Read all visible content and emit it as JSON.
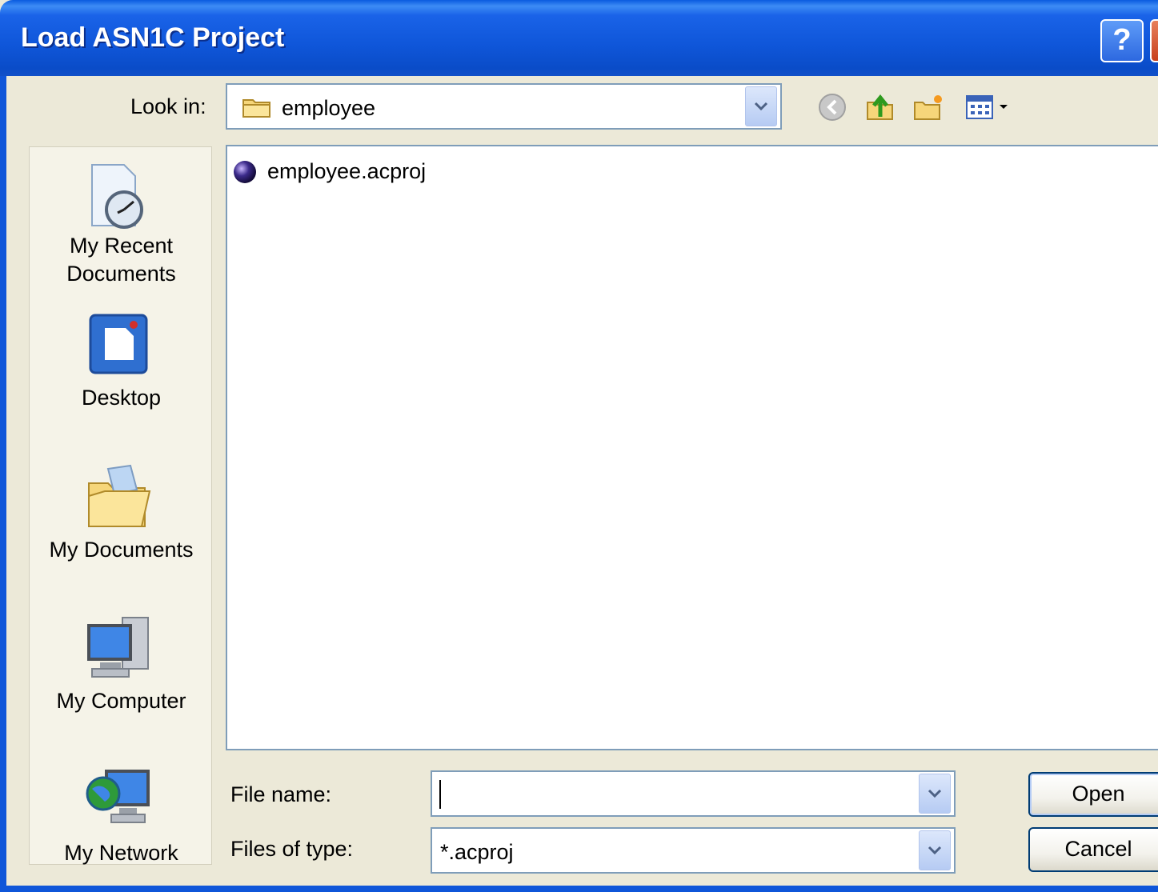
{
  "window": {
    "title": "Load ASN1C Project",
    "help_label": "?"
  },
  "lookin": {
    "label": "Look in:",
    "value": "employee"
  },
  "toolbar": {
    "icons": [
      "back-icon",
      "up-folder-icon",
      "new-folder-icon",
      "view-menu-icon"
    ]
  },
  "places": [
    {
      "label_line1": "My Recent",
      "label_line2": "Documents",
      "icon": "recent-documents-icon"
    },
    {
      "label_line1": "Desktop",
      "label_line2": "",
      "icon": "desktop-icon"
    },
    {
      "label_line1": "My Documents",
      "label_line2": "",
      "icon": "my-documents-icon"
    },
    {
      "label_line1": "My Computer",
      "label_line2": "",
      "icon": "my-computer-icon"
    },
    {
      "label_line1": "My Network",
      "label_line2": "",
      "icon": "my-network-icon"
    }
  ],
  "files": [
    {
      "name": "employee.acproj"
    }
  ],
  "filename": {
    "label": "File name:",
    "value": ""
  },
  "filetype": {
    "label": "Files of type:",
    "value": "*.acproj"
  },
  "buttons": {
    "open": "Open",
    "cancel": "Cancel"
  }
}
